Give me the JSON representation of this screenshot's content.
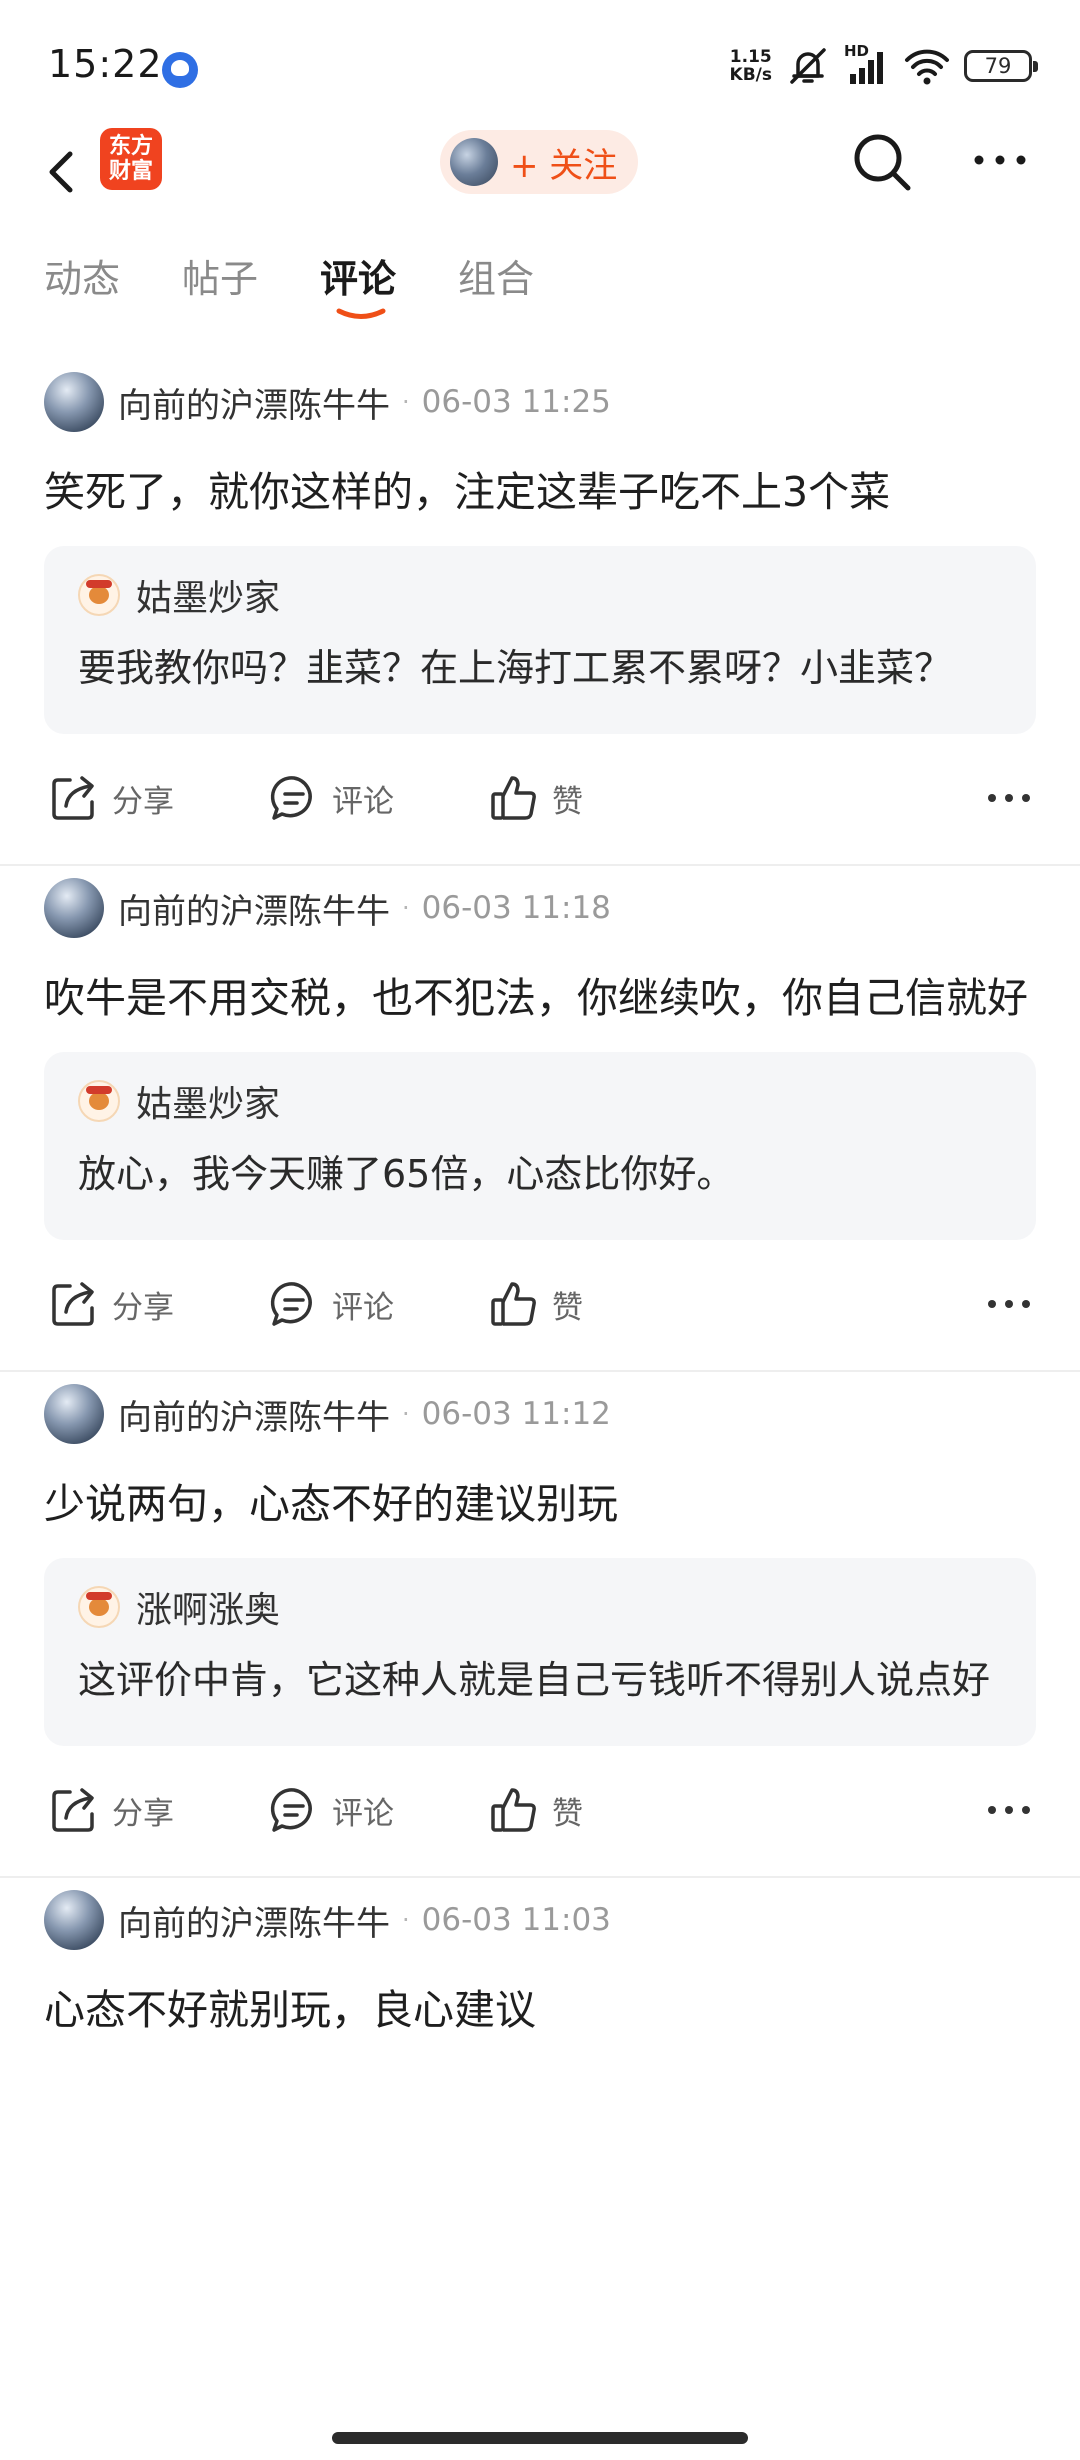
{
  "status_bar": {
    "time": "15:22",
    "net_speed_value": "1.15",
    "net_speed_unit": "KB/s",
    "signal_label": "HD",
    "battery": "79",
    "icons": [
      "baidu-app-icon",
      "mute-bell-icon",
      "cellular-signal-icon",
      "wifi-icon",
      "battery-icon"
    ]
  },
  "header": {
    "logo_line1": "东方",
    "logo_line2": "财富",
    "follow_label": "+ 关注"
  },
  "tabs": [
    {
      "label": "动态",
      "active": false
    },
    {
      "label": "帖子",
      "active": false
    },
    {
      "label": "评论",
      "active": true
    },
    {
      "label": "组合",
      "active": false
    }
  ],
  "actions": {
    "share": "分享",
    "comment": "评论",
    "like": "赞"
  },
  "posts": [
    {
      "author": "向前的沪漂陈牛牛",
      "time": "06-03 11:25",
      "text": "笑死了，就你这样的，注定这辈子吃不上3个菜",
      "quote": {
        "author": "姑墨炒家",
        "text": "要我教你吗？韭菜？在上海打工累不累呀？小韭菜？"
      }
    },
    {
      "author": "向前的沪漂陈牛牛",
      "time": "06-03 11:18",
      "text": "吹牛是不用交税，也不犯法，你继续吹，你自己信就好",
      "quote": {
        "author": "姑墨炒家",
        "text": "放心，我今天赚了65倍，心态比你好。"
      }
    },
    {
      "author": "向前的沪漂陈牛牛",
      "time": "06-03 11:12",
      "text": "少说两句，心态不好的建议别玩",
      "quote": {
        "author": "涨啊涨奥",
        "text": "这评价中肯，它这种人就是自己亏钱听不得别人说点好"
      }
    },
    {
      "author": "向前的沪漂陈牛牛",
      "time": "06-03 11:03",
      "text": "心态不好就别玩，良心建议"
    }
  ],
  "colors": {
    "accent": "#ef4f17",
    "logo_bg": "#f0431f",
    "follow_bg": "#fdebe4",
    "quote_bg": "#f5f6f8"
  }
}
